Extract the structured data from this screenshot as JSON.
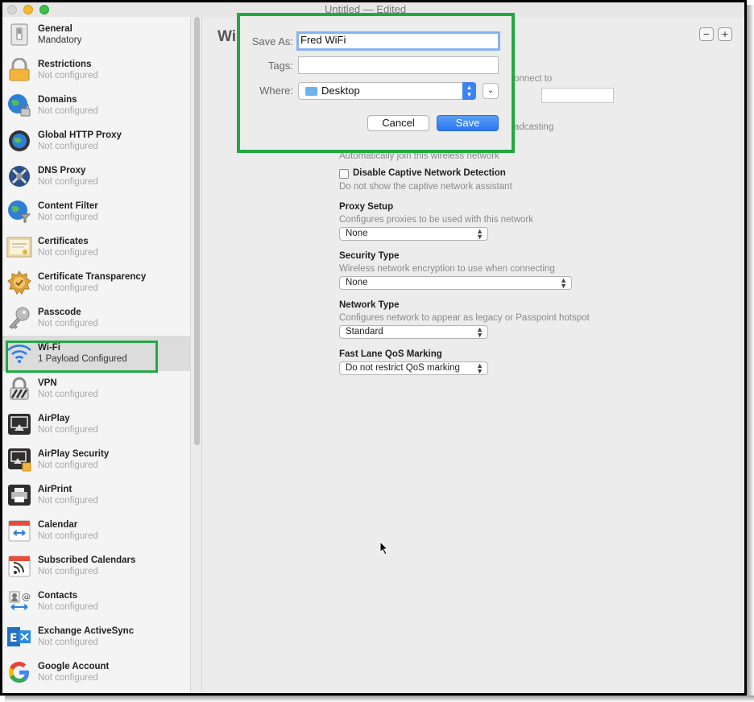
{
  "window": {
    "title": "Untitled — Edited"
  },
  "sidebar": {
    "items": [
      {
        "title": "General",
        "subtitle": "Mandatory",
        "icon": "switch-icon"
      },
      {
        "title": "Restrictions",
        "subtitle": "Not configured",
        "icon": "lock-icon"
      },
      {
        "title": "Domains",
        "subtitle": "Not configured",
        "icon": "globe-lock-icon"
      },
      {
        "title": "Global HTTP Proxy",
        "subtitle": "Not configured",
        "icon": "proxy-globe-icon"
      },
      {
        "title": "DNS Proxy",
        "subtitle": "Not configured",
        "icon": "dns-proxy-icon"
      },
      {
        "title": "Content Filter",
        "subtitle": "Not configured",
        "icon": "filter-globe-icon"
      },
      {
        "title": "Certificates",
        "subtitle": "Not configured",
        "icon": "certificate-icon"
      },
      {
        "title": "Certificate Transparency",
        "subtitle": "Not configured",
        "icon": "badge-icon"
      },
      {
        "title": "Passcode",
        "subtitle": "Not configured",
        "icon": "key-icon"
      },
      {
        "title": "Wi-Fi",
        "subtitle": "1 Payload Configured",
        "icon": "wifi-icon"
      },
      {
        "title": "VPN",
        "subtitle": "Not configured",
        "icon": "vpn-lock-icon"
      },
      {
        "title": "AirPlay",
        "subtitle": "Not configured",
        "icon": "airplay-icon"
      },
      {
        "title": "AirPlay Security",
        "subtitle": "Not configured",
        "icon": "airplay-security-icon"
      },
      {
        "title": "AirPrint",
        "subtitle": "Not configured",
        "icon": "printer-icon"
      },
      {
        "title": "Calendar",
        "subtitle": "Not configured",
        "icon": "calendar-icon"
      },
      {
        "title": "Subscribed Calendars",
        "subtitle": "Not configured",
        "icon": "subscribed-calendar-icon"
      },
      {
        "title": "Contacts",
        "subtitle": "Not configured",
        "icon": "contacts-icon"
      },
      {
        "title": "Exchange ActiveSync",
        "subtitle": "Not configured",
        "icon": "exchange-icon"
      },
      {
        "title": "Google Account",
        "subtitle": "Not configured",
        "icon": "google-icon"
      }
    ],
    "selected_index": 9
  },
  "main": {
    "title": "Wi",
    "partial_text_1": "onnect to",
    "partial_text_2": "adcasting",
    "auto_join_desc": "Automatically join this wireless network",
    "captive": {
      "label": "Disable Captive Network Detection",
      "desc": "Do not show the captive network assistant"
    },
    "proxy": {
      "label": "Proxy Setup",
      "desc": "Configures proxies to be used with this network",
      "value": "None"
    },
    "security": {
      "label": "Security Type",
      "desc": "Wireless network encryption to use when connecting",
      "value": "None"
    },
    "network_type": {
      "label": "Network Type",
      "desc": "Configures network to appear as legacy or Passpoint hotspot",
      "value": "Standard"
    },
    "qos": {
      "label": "Fast Lane QoS Marking",
      "value": "Do not restrict QoS marking"
    }
  },
  "save_sheet": {
    "save_as_label": "Save As:",
    "save_as_value": "Fred WiFi",
    "tags_label": "Tags:",
    "tags_value": "",
    "where_label": "Where:",
    "where_value": "Desktop",
    "cancel_label": "Cancel",
    "save_label": "Save"
  },
  "colors": {
    "highlight": "#22a843",
    "accent": "#2b76ef"
  }
}
